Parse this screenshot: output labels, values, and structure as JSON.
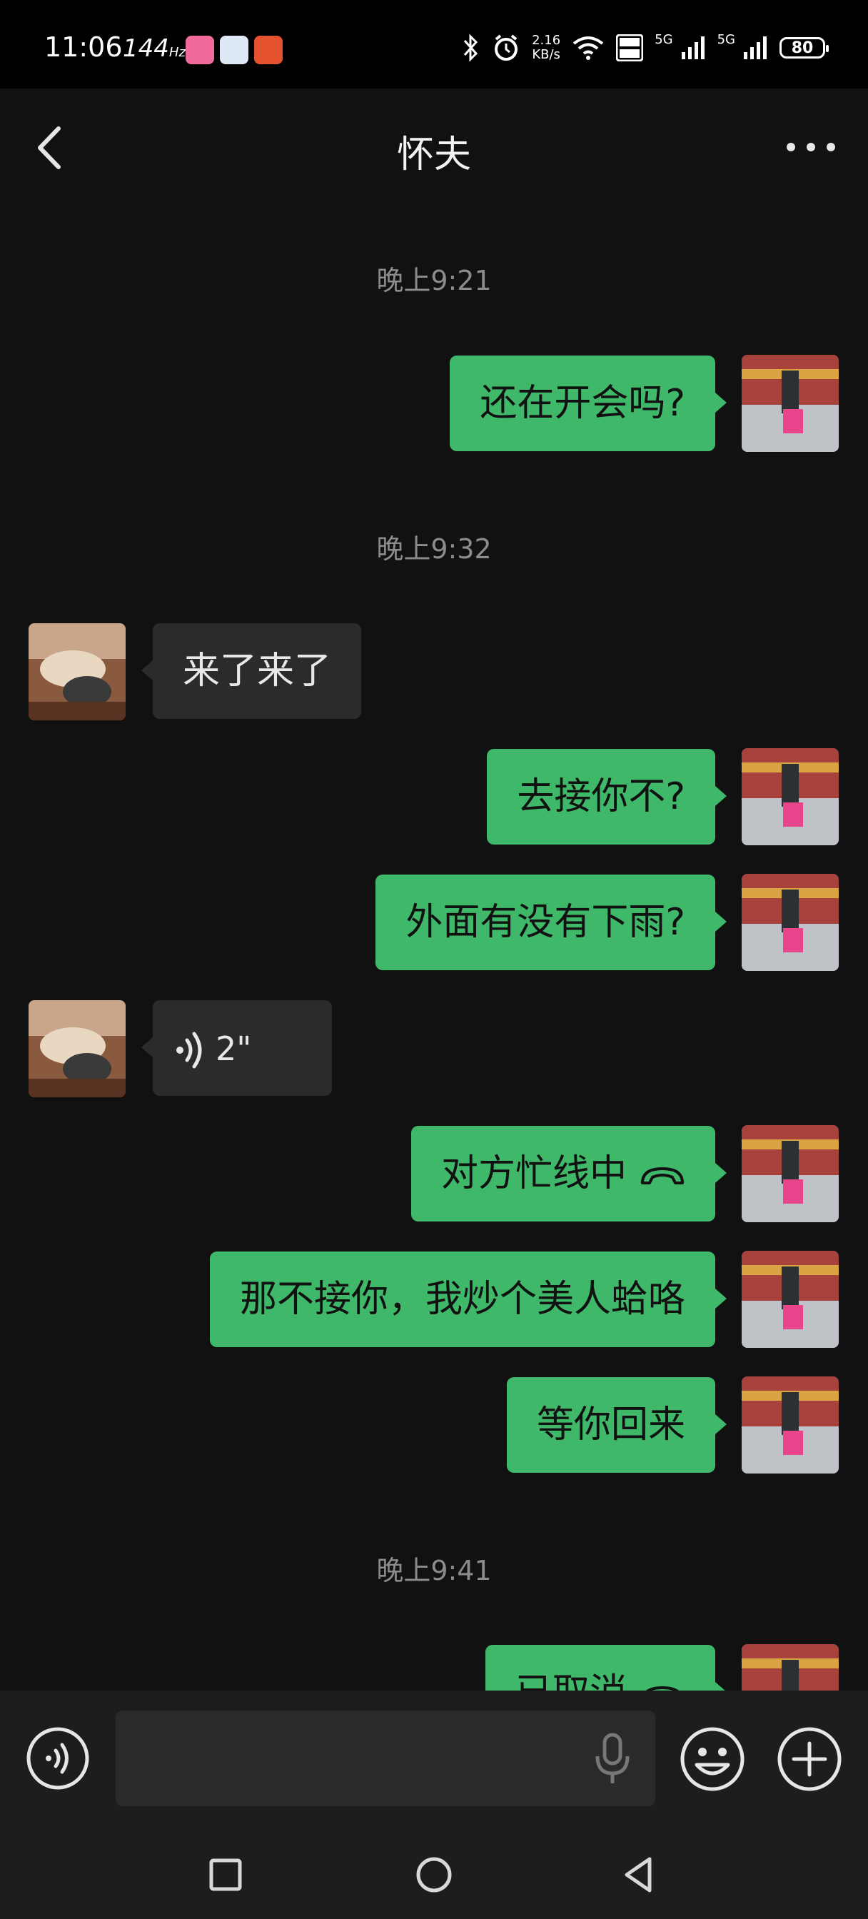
{
  "status_bar": {
    "time": "11:06",
    "refresh_rate": "144",
    "refresh_unit": "Hz",
    "net_speed_value": "2.16",
    "net_speed_unit": "KB/s",
    "signal_1_label": "5G",
    "signal_2_label": "5G",
    "battery": "80",
    "icons": [
      "bilibili-app-icon",
      "app-icon-blue",
      "app-icon-orange",
      "bluetooth-icon",
      "alarm-icon",
      "wifi-icon",
      "hd-icon",
      "signal-icon",
      "battery-icon"
    ]
  },
  "header": {
    "title": "怀夫",
    "back_icon": "chevron-left-icon",
    "more_icon": "more-dots-icon"
  },
  "messages": [
    {
      "type": "time",
      "text": "晚上9:21"
    },
    {
      "type": "text",
      "dir": "out",
      "text": "还在开会吗?"
    },
    {
      "type": "time",
      "text": "晚上9:32"
    },
    {
      "type": "text",
      "dir": "in",
      "text": "来了来了"
    },
    {
      "type": "text",
      "dir": "out",
      "text": "去接你不?"
    },
    {
      "type": "text",
      "dir": "out",
      "text": "外面有没有下雨?"
    },
    {
      "type": "voice",
      "dir": "in",
      "text": "2\""
    },
    {
      "type": "call",
      "dir": "out",
      "text": "对方忙线中"
    },
    {
      "type": "text",
      "dir": "out",
      "text": "那不接你，我炒个美人蛤咯"
    },
    {
      "type": "text",
      "dir": "out",
      "text": "等你回来"
    },
    {
      "type": "time",
      "text": "晚上9:41"
    },
    {
      "type": "call",
      "dir": "out",
      "text": "已取消"
    }
  ],
  "input_bar": {
    "value": "",
    "placeholder": "",
    "icons": [
      "voice-toggle-icon",
      "mic-icon",
      "emoji-icon",
      "plus-icon"
    ]
  },
  "nav_bar": {
    "icons": [
      "recents-square-icon",
      "home-circle-icon",
      "back-triangle-icon"
    ]
  },
  "colors": {
    "background": "#111111",
    "outgoing_bubble": "#3fb86a",
    "incoming_bubble": "#2b2b2b",
    "timestamp_text": "#8c8c8c",
    "bar_background": "#1d1d1d"
  }
}
